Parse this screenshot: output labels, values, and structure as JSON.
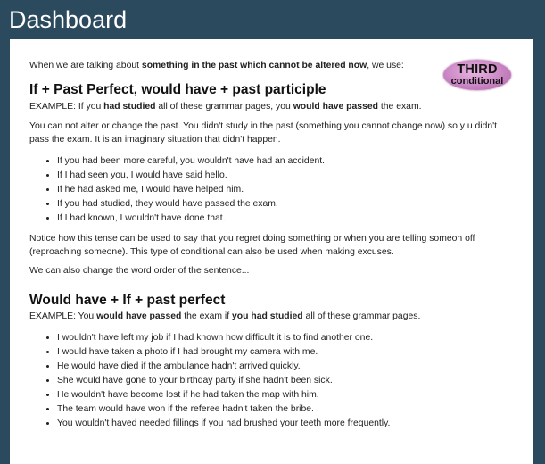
{
  "app": {
    "title": "Dashboard"
  },
  "badge": {
    "line1": "THIRD",
    "line2": "conditional"
  },
  "section1": {
    "intro_pre": "When we are talking about ",
    "intro_bold": "something in the past which cannot be altered now",
    "intro_post": ", we use:",
    "heading": "If + Past Perfect, would have + past participle",
    "example_a": "EXAMPLE: If you ",
    "example_b": "had studied",
    "example_c": " all of these grammar pages, you ",
    "example_d": "would have passed",
    "example_e": " the exam.",
    "para": "You can not alter or change the past. You didn't study in the past (something you cannot change now) so y  u didn't pass the exam. It is an imaginary situation that didn't happen.",
    "bullets": [
      "If you had been more careful, you wouldn't have had an accident.",
      "If I had seen you, I would have said hello.",
      "If he had asked me, I would have helped him.",
      "If you had studied, they would have passed the exam.",
      "If I had known, I wouldn't have done that."
    ],
    "notice": "Notice how this tense can be used to say that you regret doing something or when you are telling someon   off (reproaching someone). This type of conditional can also be used when making excuses.",
    "word_order": "We can also change the word order of the sentence..."
  },
  "section2": {
    "heading": "Would have + If + past perfect",
    "example_a": "EXAMPLE: You ",
    "example_b": "would have passed",
    "example_c": " the exam if ",
    "example_d": "you had studied",
    "example_e": " all of these grammar pages.",
    "bullets": [
      "I wouldn't have left my job if I had known how difficult it is to find another one.",
      "I would have taken a photo if I had brought my camera with me.",
      "He would have died if the ambulance hadn't arrived quickly.",
      "She would have gone to your birthday party if she hadn't been sick.",
      "He wouldn't have become lost if he had taken the map with him.",
      "The team would have won if the referee hadn't taken the bribe.",
      "You wouldn't haved needed fillings if you had brushed your teeth more frequently."
    ]
  }
}
